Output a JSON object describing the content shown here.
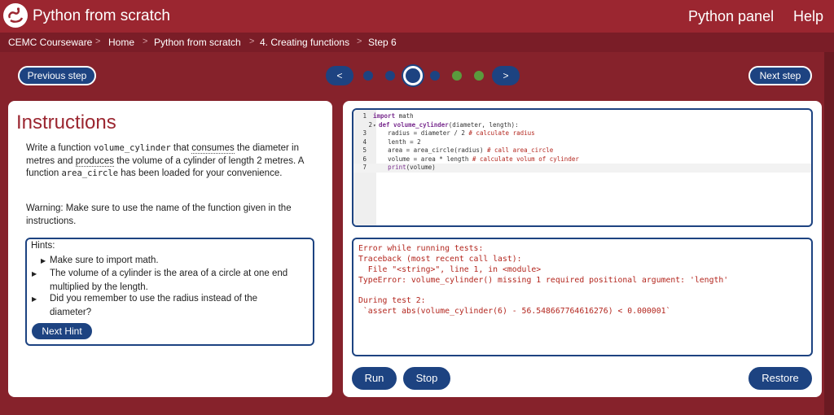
{
  "header": {
    "title": "Python from scratch",
    "panel_link": "Python panel",
    "help_link": "Help",
    "logo_icon": "python-snake-logo"
  },
  "breadcrumb": [
    "CEMC Courseware",
    "Home",
    "Python from scratch",
    "4. Creating functions",
    "Step 6"
  ],
  "breadcrumb_sep": ">",
  "nav": {
    "previous": "Previous step",
    "next": "Next step",
    "left_arrow": "<",
    "right_arrow": ">",
    "dots": [
      "done",
      "done",
      "current",
      "todo",
      "green",
      "green"
    ]
  },
  "instructions": {
    "title": "Instructions",
    "p1_a": "Write a function ",
    "p1_code1": "volume_cylinder",
    "p1_b": " that ",
    "p1_dotted1": "consumes",
    "p1_c": " the diameter in metres and ",
    "p1_dotted2": "produces",
    "p1_d": " the volume of a cylinder of length 2 metres. A function ",
    "p1_code2": "area_circle",
    "p1_e": " has been loaded for your convenience.",
    "warning": "Warning: Make sure to use the name of the function given in the instructions.",
    "hints_label": "Hints:",
    "hints": [
      "Make sure to import math.",
      "The volume of a cylinder is the area of a circle at one end multiplied by the length.",
      "Did you remember to use the radius instead of the diameter?"
    ],
    "next_hint": "Next Hint"
  },
  "editor": {
    "line_numbers": [
      "1",
      "2",
      "3",
      "4",
      "5",
      "6",
      "7"
    ],
    "fold_marker": "▾",
    "lines": [
      {
        "kw": "import",
        "rest": " math",
        "cm": ""
      },
      {
        "kw": "def",
        "fn": " volume_cylinder",
        "rest": "(diameter, length):",
        "cm": ""
      },
      {
        "indent": "    ",
        "rest": "radius = diameter / 2 ",
        "cm": "# calculate radius"
      },
      {
        "indent": "    ",
        "rest": "lenth = 2",
        "cm": ""
      },
      {
        "indent": "    ",
        "rest": "area = area_circle(radius) ",
        "cm": "# call area_circle"
      },
      {
        "indent": "    ",
        "rest": "volume = area * length ",
        "cm": "# calculate volum of cylinder"
      },
      {
        "indent": "    ",
        "bi": "print",
        "rest": "(volume)",
        "cm": ""
      }
    ]
  },
  "output": {
    "lines": [
      "Error while running tests:",
      "Traceback (most recent call last):",
      "  File \"<string>\", line 1, in <module>",
      "TypeError: volume_cylinder() missing 1 required positional argument: 'length'",
      "",
      "During test 2:",
      " `assert abs(volume_cylinder(6) - 56.548667764616276) < 0.000001`"
    ]
  },
  "buttons": {
    "run": "Run",
    "stop": "Stop",
    "restore": "Restore"
  },
  "colors": {
    "brand": "#9b2630",
    "button": "#1d4381",
    "error": "#b3261e",
    "green_dot": "#5a9b3d"
  }
}
